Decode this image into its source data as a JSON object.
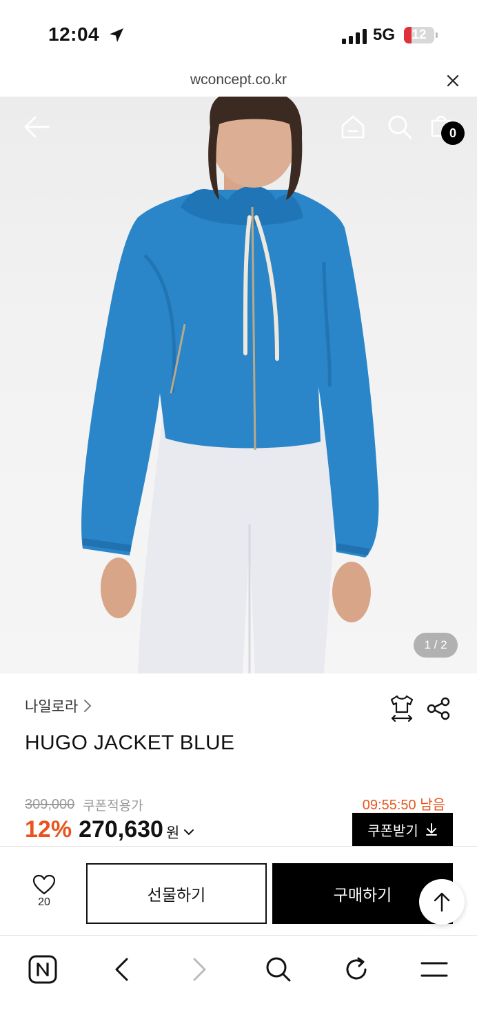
{
  "status_bar": {
    "time": "12:04",
    "network": "5G",
    "battery": "12"
  },
  "url_bar": {
    "url": "wconcept.co.kr"
  },
  "hero": {
    "cart_count": "0",
    "pager": "1 / 2"
  },
  "product": {
    "brand": "나일로라",
    "title": "HUGO JACKET BLUE",
    "original_price": "309,000",
    "coupon_note": "쿠폰적용가",
    "timer": "09:55:50 남음",
    "discount": "12%",
    "sale_price": "270,630",
    "currency": "원",
    "coupon_button": "쿠폰받기"
  },
  "actions": {
    "wish_count": "20",
    "gift_label": "선물하기",
    "buy_label": "구매하기"
  },
  "colors": {
    "accent": "#e8541c",
    "jacket": "#2a86c8",
    "primary": "#000000"
  },
  "icons": {
    "hero": [
      "back-arrow-icon",
      "home-icon",
      "search-icon",
      "shopping-bag-icon"
    ],
    "product": [
      "chevron-right-icon",
      "size-guide-icon",
      "share-icon",
      "chevron-down-icon",
      "download-icon"
    ],
    "toolbar": [
      "naver-icon",
      "back-icon",
      "forward-icon",
      "search-icon",
      "refresh-icon",
      "menu-icon"
    ]
  }
}
